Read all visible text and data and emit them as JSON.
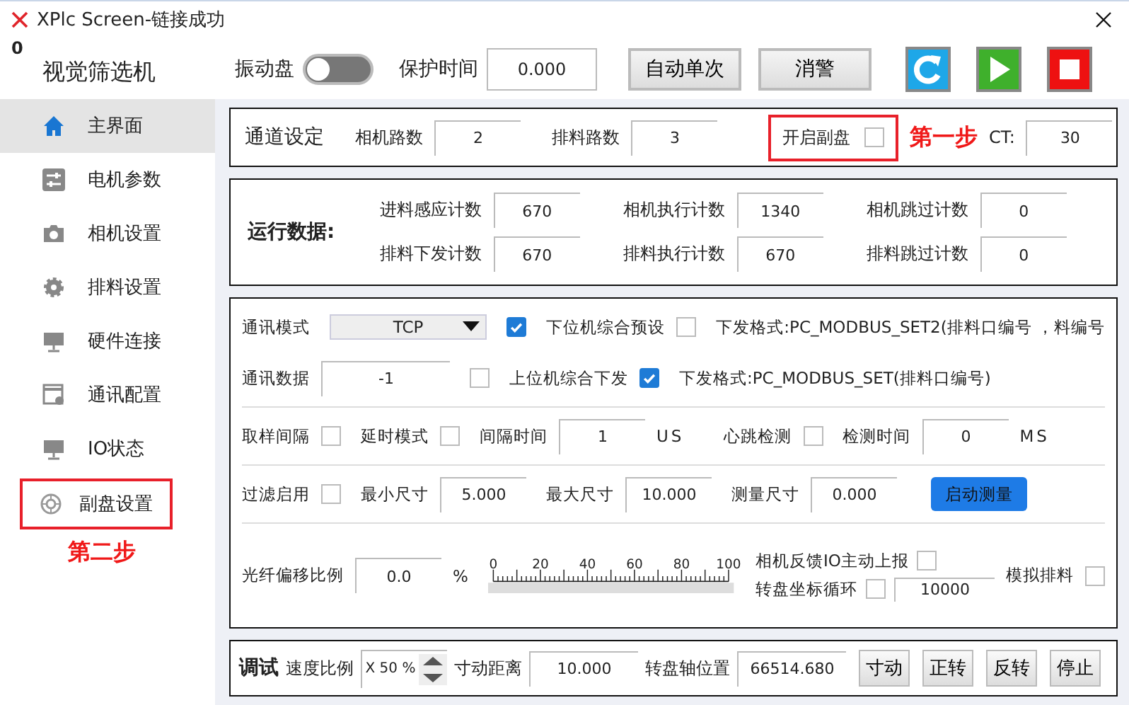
{
  "window": {
    "title": "XPlc Screen-链接成功"
  },
  "corner_value": "0",
  "app_title": "视觉筛选机",
  "toolbar": {
    "switch": {
      "label": "振动盘",
      "on": false
    },
    "protect_time": {
      "label": "保护时间",
      "value": "0.000"
    },
    "buttons": [
      "自动单次",
      "消警"
    ],
    "icon_buttons": [
      {
        "kind": "refresh"
      },
      {
        "kind": "play"
      },
      {
        "kind": "stop"
      }
    ]
  },
  "sidebar": {
    "items": [
      {
        "label": "主界面",
        "kind": "home",
        "selected": true,
        "highlighted": false
      },
      {
        "label": "电机参数",
        "kind": "sliders",
        "selected": false,
        "highlighted": false
      },
      {
        "label": "相机设置",
        "kind": "camera",
        "selected": false,
        "highlighted": false
      },
      {
        "label": "排料设置",
        "kind": "gear",
        "selected": false,
        "highlighted": false
      },
      {
        "label": "硬件连接",
        "kind": "monitor",
        "selected": false,
        "highlighted": false
      },
      {
        "label": "通讯配置",
        "kind": "window",
        "selected": false,
        "highlighted": false
      },
      {
        "label": "IO状态",
        "kind": "monitor",
        "selected": false,
        "highlighted": false
      },
      {
        "label": "副盘设置",
        "kind": "ring",
        "selected": false,
        "highlighted": true
      }
    ],
    "note": "第二步"
  },
  "channel_settings": {
    "title": "通道设定",
    "fields": [
      {
        "label": "相机路数",
        "value": "2"
      },
      {
        "label": "排料路数",
        "value": "3"
      }
    ],
    "sub_disc": {
      "label": "开启副盘",
      "checked": false,
      "highlighted": true
    },
    "note": "第一步",
    "ct": {
      "label": "CT:",
      "value": "30"
    }
  },
  "run_data": {
    "title": "运行数据:",
    "rows": [
      [
        {
          "label": "进料感应计数",
          "value": "670"
        },
        {
          "label": "相机执行计数",
          "value": "1340"
        },
        {
          "label": "相机跳过计数",
          "value": "0"
        }
      ],
      [
        {
          "label": "排料下发计数",
          "value": "670"
        },
        {
          "label": "排料执行计数",
          "value": "670"
        },
        {
          "label": "排料跳过计数",
          "value": "0"
        }
      ]
    ]
  },
  "settings": {
    "sections": [
      {
        "rows": [
          {
            "items": [
              {
                "kind": "label",
                "text": "通讯模式"
              },
              {
                "kind": "dropdown",
                "value": "TCP"
              },
              {
                "kind": "check",
                "checked": true
              },
              {
                "kind": "label",
                "text": "下位机综合预设"
              },
              {
                "kind": "check",
                "checked": false
              },
              {
                "kind": "label",
                "text": "下发格式:PC_MODBUS_SET2(排料口编号 ，料编号"
              }
            ]
          },
          {
            "items": [
              {
                "kind": "label",
                "text": "通讯数据"
              },
              {
                "kind": "field",
                "value": "-1"
              },
              {
                "kind": "check",
                "checked": false
              },
              {
                "kind": "label",
                "text": "上位机综合下发"
              },
              {
                "kind": "check",
                "checked": true
              },
              {
                "kind": "label",
                "text": "下发格式:PC_MODBUS_SET(排料口编号)"
              }
            ]
          }
        ]
      },
      {
        "rows": [
          {
            "items": [
              {
                "kind": "label",
                "text": "取样间隔"
              },
              {
                "kind": "check",
                "checked": false
              },
              {
                "kind": "label",
                "text": "延时模式"
              },
              {
                "kind": "check",
                "checked": false
              },
              {
                "kind": "label",
                "text": "间隔时间"
              },
              {
                "kind": "field",
                "value": "1"
              },
              {
                "kind": "unit",
                "text": "US"
              },
              {
                "kind": "label",
                "text": "心跳检测"
              },
              {
                "kind": "check",
                "checked": false
              },
              {
                "kind": "label",
                "text": "检测时间"
              },
              {
                "kind": "field",
                "value": "0"
              },
              {
                "kind": "unit",
                "text": "MS"
              }
            ]
          }
        ]
      },
      {
        "rows": [
          {
            "items": [
              {
                "kind": "label",
                "text": "过滤启用"
              },
              {
                "kind": "check",
                "checked": false
              },
              {
                "kind": "label",
                "text": "最小尺寸"
              },
              {
                "kind": "field",
                "value": "5.000"
              },
              {
                "kind": "label",
                "text": "最大尺寸"
              },
              {
                "kind": "field",
                "value": "10.000"
              },
              {
                "kind": "label",
                "text": "测量尺寸"
              },
              {
                "kind": "field",
                "value": "0.000"
              },
              {
                "kind": "button",
                "text": "启动测量"
              }
            ]
          }
        ]
      }
    ]
  },
  "fiber": {
    "label": "光纤偏移比例",
    "value": "0.0",
    "unit": "%",
    "slider": {
      "ticks": [
        "0",
        "20",
        "40",
        "60",
        "80",
        "100"
      ]
    },
    "options": [
      {
        "label": "相机反馈IO主动上报",
        "checked": false
      },
      {
        "label": "转盘坐标循环",
        "checked": false,
        "value": "10000"
      }
    ],
    "simulate": {
      "label": "模拟排料",
      "checked": false
    }
  },
  "debug": {
    "title": "调试",
    "items": [
      {
        "kind": "label",
        "text": "速度比例"
      },
      {
        "kind": "spinner",
        "value": "X 50 %"
      },
      {
        "kind": "label",
        "text": "寸动距离"
      },
      {
        "kind": "field",
        "value": "10.000"
      },
      {
        "kind": "label",
        "text": "转盘轴位置"
      },
      {
        "kind": "field",
        "value": "66514.680"
      },
      {
        "kind": "gbutton",
        "text": "寸动"
      },
      {
        "kind": "gbutton",
        "text": "正转"
      },
      {
        "kind": "gbutton",
        "text": "反转"
      },
      {
        "kind": "gbutton",
        "text": "停止"
      }
    ]
  }
}
